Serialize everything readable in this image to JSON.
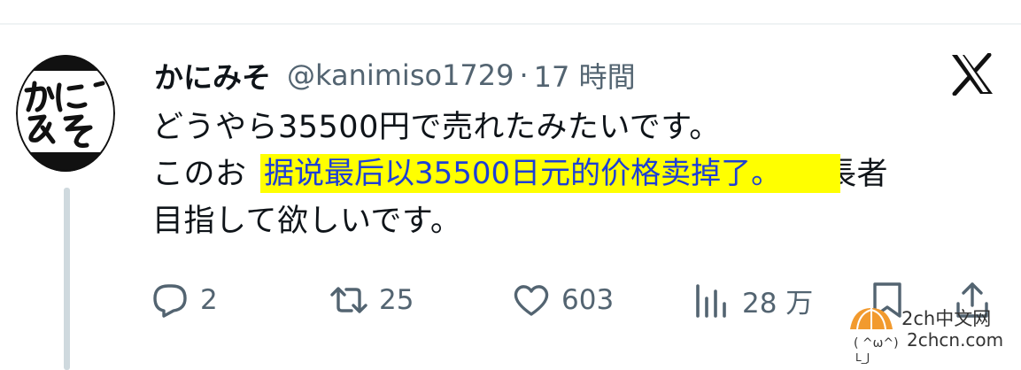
{
  "tweet": {
    "display_name": "かにみそ",
    "handle": "@kanimiso1729",
    "separator": "·",
    "time": "17 時間",
    "text_lines": [
      "どうやら35500円で売れたみたいです。",
      "このお",
      "目指して欲しいです。"
    ],
    "text_line2_tail": "万長者",
    "overlay_caption": "据说最后以35500日元的价格卖掉了。"
  },
  "actions": {
    "replies": "2",
    "retweets": "25",
    "likes": "603",
    "views": "28 万"
  },
  "avatar": {
    "lettering": "かにみそ"
  },
  "watermark": {
    "line1": "2ch中文网",
    "line2": "2chcn.com"
  },
  "colors": {
    "text": "#0f1419",
    "secondary": "#536471",
    "highlight": "#ffff00",
    "overlay_text": "#1d3fd6",
    "thread_line": "#cfd9de"
  },
  "icons": [
    "x-logo-icon",
    "reply-icon",
    "retweet-icon",
    "like-icon",
    "views-icon",
    "bookmark-icon",
    "share-icon"
  ]
}
